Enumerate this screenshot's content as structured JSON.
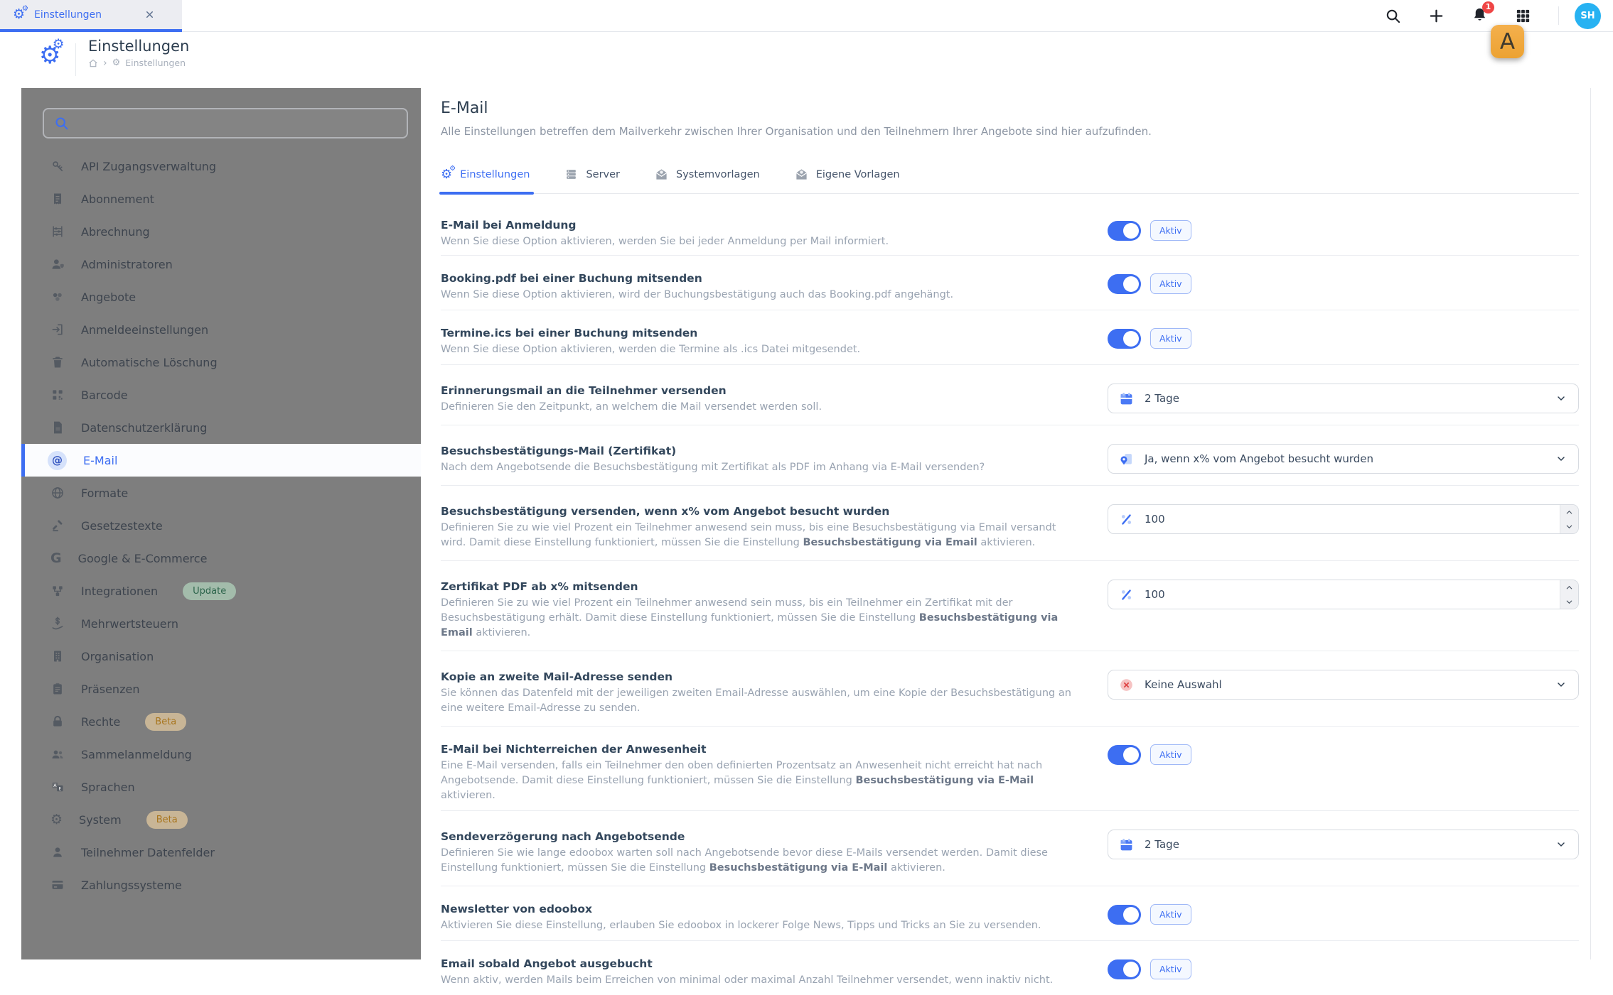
{
  "browser_tab": {
    "title": "Einstellungen"
  },
  "topbar": {
    "actions": [
      {
        "icon": "search",
        "name": "search-icon"
      },
      {
        "icon": "plus",
        "name": "plus-icon"
      },
      {
        "icon": "bell",
        "name": "notifications-icon",
        "badge": "1"
      },
      {
        "icon": "grid",
        "name": "apps-grid-icon"
      }
    ],
    "avatar_initials": "SH"
  },
  "annotation": {
    "label": "A",
    "color": "#eca232"
  },
  "header": {
    "title": "Einstellungen",
    "breadcrumb_label": "Einstellungen"
  },
  "sidebar": {
    "search_value": "",
    "items": [
      {
        "label": "API Zugangsverwaltung",
        "icon": "key"
      },
      {
        "label": "Abonnement",
        "icon": "receipt"
      },
      {
        "label": "Abrechnung",
        "icon": "abacus"
      },
      {
        "label": "Administratoren",
        "icon": "admin"
      },
      {
        "label": "Angebote",
        "icon": "cluster"
      },
      {
        "label": "Anmeldeeinstellungen",
        "icon": "login"
      },
      {
        "label": "Automatische Löschung",
        "icon": "trash"
      },
      {
        "label": "Barcode",
        "icon": "qr"
      },
      {
        "label": "Datenschutzerklärung",
        "icon": "doc"
      },
      {
        "label": "E-Mail",
        "icon": "at",
        "active": true
      },
      {
        "label": "Formate",
        "icon": "globe"
      },
      {
        "label": "Gesetzestexte",
        "icon": "law"
      },
      {
        "label": "Google & E-Commerce",
        "icon": "g"
      },
      {
        "label": "Integrationen",
        "icon": "nodes",
        "badge": {
          "label": "Update",
          "type": "update"
        }
      },
      {
        "label": "Mehrwertsteuern",
        "icon": "tax"
      },
      {
        "label": "Organisation",
        "icon": "building"
      },
      {
        "label": "Präsenzen",
        "icon": "clipboard"
      },
      {
        "label": "Rechte",
        "icon": "lock",
        "badge": {
          "label": "Beta",
          "type": "beta"
        }
      },
      {
        "label": "Sammelanmeldung",
        "icon": "people"
      },
      {
        "label": "Sprachen",
        "icon": "translate"
      },
      {
        "label": "System",
        "icon": "gear",
        "badge": {
          "label": "Beta",
          "type": "beta"
        }
      },
      {
        "label": "Teilnehmer Datenfelder",
        "icon": "person"
      },
      {
        "label": "Zahlungssysteme",
        "icon": "card"
      }
    ]
  },
  "main": {
    "title": "E-Mail",
    "description": "Alle Einstellungen betreffen dem Mailverkehr zwischen Ihrer Organisation und den Teilnehmern Ihrer Angebote sind hier aufzufinden.",
    "tabs": [
      {
        "label": "Einstellungen",
        "icon": "gears",
        "active": true
      },
      {
        "label": "Server",
        "icon": "server",
        "active": false
      },
      {
        "label": "Systemvorlagen",
        "icon": "mailopen",
        "active": false
      },
      {
        "label": "Eigene Vorlagen",
        "icon": "mailopen",
        "active": false
      }
    ],
    "rows": [
      {
        "title": "E-Mail bei Anmeldung",
        "desc_parts": [
          {
            "t": "Wenn Sie diese Option aktivieren, werden Sie bei jeder Anmeldung per Mail informiert."
          }
        ],
        "control": {
          "type": "toggle",
          "state": "on",
          "label": "Aktiv"
        }
      },
      {
        "title": "Booking.pdf bei einer Buchung mitsenden",
        "desc_parts": [
          {
            "t": "Wenn Sie diese Option aktivieren, wird der Buchungsbestätigung auch das Booking.pdf angehängt."
          }
        ],
        "control": {
          "type": "toggle",
          "state": "on",
          "label": "Aktiv"
        }
      },
      {
        "title": "Termine.ics bei einer Buchung mitsenden",
        "desc_parts": [
          {
            "t": "Wenn Sie diese Option aktivieren, werden die Termine als .ics Datei mitgesendet."
          }
        ],
        "control": {
          "type": "toggle",
          "state": "on",
          "label": "Aktiv"
        }
      },
      {
        "title": "Erinnerungsmail an die Teilnehmer versenden",
        "desc_parts": [
          {
            "t": "Definieren Sie den Zeitpunkt, an welchem die Mail versendet werden soll."
          }
        ],
        "control": {
          "type": "select",
          "icon": "calendar",
          "value": "2 Tage"
        }
      },
      {
        "title": "Besuchsbestätigungs-Mail (Zertifikat)",
        "desc_parts": [
          {
            "t": "Nach dem Angebotsende die Besuchsbestätigung mit Zertifikat als PDF im Anhang via E-Mail versenden?"
          }
        ],
        "control": {
          "type": "select",
          "icon": "cert",
          "value": "Ja, wenn x% vom Angebot besucht wurden"
        }
      },
      {
        "title": "Besuchsbestätigung versenden, wenn x% vom Angebot besucht wurden",
        "desc_parts": [
          {
            "t": "Definieren Sie zu wie viel Prozent ein Teilnehmer anwesend sein muss, bis eine Besuchsbestätigung via Email versandt wird. Damit diese Einstellung funktioniert, müssen Sie die Einstellung "
          },
          {
            "t": "Besuchsbestätigung via Email",
            "b": true
          },
          {
            "t": " aktivieren."
          }
        ],
        "control": {
          "type": "number",
          "icon": "percent",
          "value": "100"
        }
      },
      {
        "title": "Zertifikat PDF ab x% mitsenden",
        "desc_parts": [
          {
            "t": "Definieren Sie zu wie viel Prozent ein Teilnehmer anwesend sein muss, bis ein Teilnehmer ein Zertifikat mit der Besuchsbestätigung erhält. Damit diese Einstellung funktioniert, müssen Sie die Einstellung "
          },
          {
            "t": "Besuchsbestätigung via Email",
            "b": true
          },
          {
            "t": " aktivieren."
          }
        ],
        "control": {
          "type": "number",
          "icon": "percent",
          "value": "100"
        }
      },
      {
        "title": "Kopie an zweite Mail-Adresse senden",
        "desc_parts": [
          {
            "t": "Sie können das Datenfeld mit der jeweiligen zweiten Email-Adresse auswählen, um eine Kopie der Besuchsbestätigung an eine weitere Email-Adresse zu senden."
          }
        ],
        "control": {
          "type": "select",
          "icon": "xcircle",
          "value": "Keine Auswahl"
        }
      },
      {
        "title": "E-Mail bei Nichterreichen der Anwesenheit",
        "desc_parts": [
          {
            "t": "Eine E-Mail versenden, falls ein Teilnehmer den oben definierten Prozentsatz an Anwesenheit nicht erreicht hat nach Angebotsende. Damit diese Einstellung funktioniert, müssen Sie die Einstellung "
          },
          {
            "t": "Besuchsbestätigung via E-Mail",
            "b": true
          },
          {
            "t": " aktivieren."
          }
        ],
        "control": {
          "type": "toggle",
          "state": "on",
          "label": "Aktiv"
        }
      },
      {
        "title": "Sendeverzögerung nach Angebotsende",
        "desc_parts": [
          {
            "t": "Definieren Sie wie lange edoobox warten soll nach Angebotsende bevor diese E-Mails versendet werden. Damit diese Einstellung funktioniert, müssen Sie die Einstellung "
          },
          {
            "t": "Besuchsbestätigung via E-Mail",
            "b": true
          },
          {
            "t": " aktivieren."
          }
        ],
        "control": {
          "type": "select",
          "icon": "calendar",
          "value": "2 Tage"
        }
      },
      {
        "title": "Newsletter von edoobox",
        "desc_parts": [
          {
            "t": "Aktivieren Sie diese Einstellung, erlauben Sie edoobox in lockerer Folge News, Tipps und Tricks an Sie zu versenden."
          }
        ],
        "control": {
          "type": "toggle",
          "state": "on",
          "label": "Aktiv"
        }
      },
      {
        "title": "Email sobald Angebot ausgebucht",
        "desc_parts": [
          {
            "t": "Wenn aktiv, werden Mails beim Erreichen von minimal oder maximal Anzahl Teilnehmer versendet, wenn inaktiv nicht."
          }
        ],
        "control": {
          "type": "toggle",
          "state": "on",
          "label": "Aktiv"
        }
      }
    ]
  },
  "colors": {
    "accent": "#3d6ef2",
    "sidebar_dim": "#7e7e7e",
    "badge_red": "#ef4545",
    "avatar_bg": "#27b2f2",
    "marker_orange": "#eca232"
  }
}
